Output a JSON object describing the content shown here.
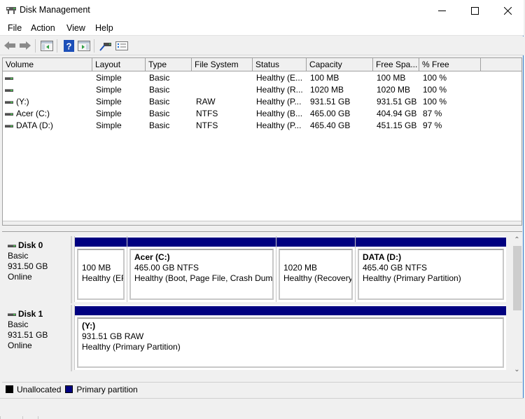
{
  "window": {
    "title": "Disk Management",
    "icons": {
      "app": "disk-management-icon",
      "minimize": "minimize-icon",
      "maximize": "maximize-icon",
      "close": "close-icon"
    }
  },
  "menu": [
    "File",
    "Action",
    "View",
    "Help"
  ],
  "toolbar": [
    {
      "name": "back-button",
      "icon": "back-arrow-icon"
    },
    {
      "name": "forward-button",
      "icon": "forward-arrow-icon"
    },
    {
      "name": "show-hide-console-tree-button",
      "icon": "console-tree-icon"
    },
    {
      "name": "help-button",
      "icon": "help-icon"
    },
    {
      "name": "show-hide-action-pane-button",
      "icon": "action-pane-icon"
    },
    {
      "name": "connect-disk-button",
      "icon": "connect-icon"
    },
    {
      "name": "properties-button",
      "icon": "properties-icon"
    }
  ],
  "volume_list": {
    "columns": [
      "Volume",
      "Layout",
      "Type",
      "File System",
      "Status",
      "Capacity",
      "Free Spa...",
      "% Free"
    ],
    "rows": [
      {
        "volume": "",
        "layout": "Simple",
        "type": "Basic",
        "fs": "",
        "status": "Healthy (E...",
        "capacity": "100 MB",
        "free": "100 MB",
        "pct": "100 %"
      },
      {
        "volume": "",
        "layout": "Simple",
        "type": "Basic",
        "fs": "",
        "status": "Healthy (R...",
        "capacity": "1020 MB",
        "free": "1020 MB",
        "pct": "100 %"
      },
      {
        "volume": " (Y:)",
        "layout": "Simple",
        "type": "Basic",
        "fs": "RAW",
        "status": "Healthy (P...",
        "capacity": "931.51 GB",
        "free": "931.51 GB",
        "pct": "100 %"
      },
      {
        "volume": "Acer (C:)",
        "layout": "Simple",
        "type": "Basic",
        "fs": "NTFS",
        "status": "Healthy (B...",
        "capacity": "465.00 GB",
        "free": "404.94 GB",
        "pct": "87 %"
      },
      {
        "volume": "DATA (D:)",
        "layout": "Simple",
        "type": "Basic",
        "fs": "NTFS",
        "status": "Healthy (P...",
        "capacity": "465.40 GB",
        "free": "451.15 GB",
        "pct": "97 %"
      }
    ]
  },
  "disks": [
    {
      "name": "Disk 0",
      "type": "Basic",
      "size": "931.50 GB",
      "state": "Online",
      "partitions": [
        {
          "title": "",
          "line1": "100 MB",
          "line2": "Healthy (EF"
        },
        {
          "title": "Acer  (C:)",
          "line1": "465.00 GB NTFS",
          "line2": "Healthy (Boot, Page File, Crash Dump,"
        },
        {
          "title": "",
          "line1": "1020 MB",
          "line2": "Healthy (Recovery"
        },
        {
          "title": "DATA  (D:)",
          "line1": "465.40 GB NTFS",
          "line2": "Healthy (Primary Partition)"
        }
      ]
    },
    {
      "name": "Disk 1",
      "type": "Basic",
      "size": "931.51 GB",
      "state": "Online",
      "partitions": [
        {
          "title": "  (Y:)",
          "line1": "931.51 GB RAW",
          "line2": "Healthy (Primary Partition)"
        }
      ]
    }
  ],
  "legend": [
    {
      "label": "Unallocated",
      "color": "#000000"
    },
    {
      "label": "Primary partition",
      "color": "#000080"
    }
  ],
  "colors": {
    "primary_partition": "#000080",
    "unallocated": "#000000"
  }
}
